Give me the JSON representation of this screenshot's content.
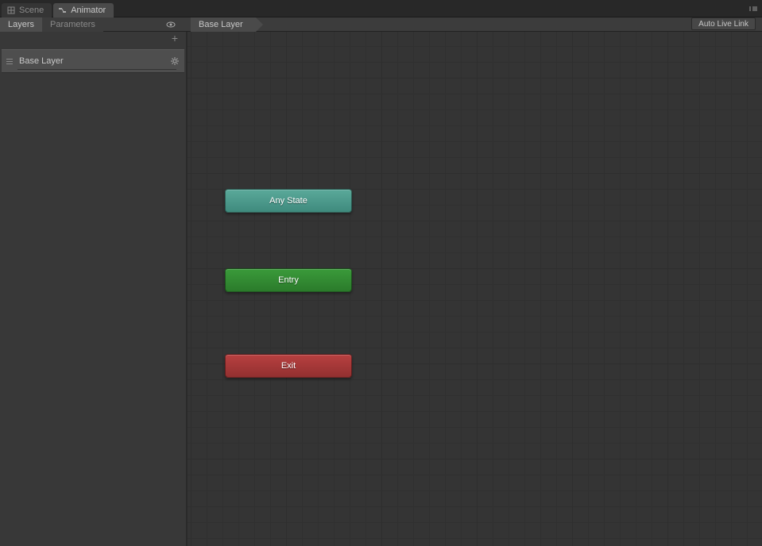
{
  "tabs": {
    "scene": "Scene",
    "animator": "Animator"
  },
  "subTabs": {
    "layers": "Layers",
    "parameters": "Parameters"
  },
  "breadcrumb": {
    "root": "Base Layer"
  },
  "toolbar": {
    "autoLiveLink": "Auto Live Link"
  },
  "sidebar": {
    "layers": [
      {
        "name": "Base Layer"
      }
    ]
  },
  "states": {
    "anyState": "Any State",
    "entry": "Entry",
    "exit": "Exit"
  }
}
